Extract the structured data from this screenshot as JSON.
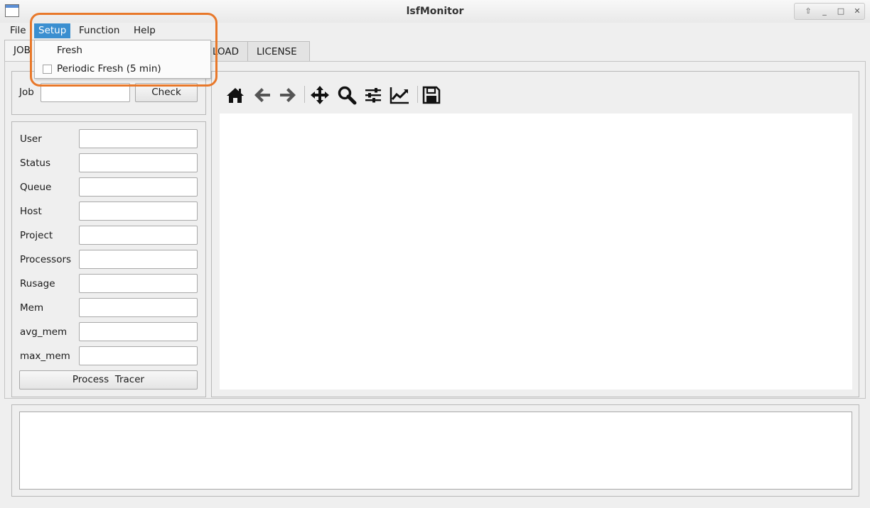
{
  "window": {
    "title": "lsfMonitor",
    "controls": [
      "⇧",
      "_",
      "□",
      "✕"
    ]
  },
  "menubar": {
    "items": [
      "File",
      "Setup",
      "Function",
      "Help"
    ],
    "active": "Setup"
  },
  "setup_menu": {
    "items": [
      {
        "label": "Fresh",
        "checkable": false
      },
      {
        "label": "Periodic Fresh (5 min)",
        "checkable": true,
        "checked": false
      }
    ]
  },
  "tabs": [
    "JOB",
    "LOAD",
    "LICENSE"
  ],
  "job_check": {
    "label": "Job",
    "value": "",
    "button": "Check"
  },
  "job_fields": [
    "User",
    "Status",
    "Queue",
    "Host",
    "Project",
    "Processors",
    "Rusage",
    "Mem",
    "avg_mem",
    "max_mem"
  ],
  "process_tracer_button": "Process  Tracer",
  "plot_toolbar": {
    "icons": [
      "home-icon",
      "back-arrow-icon",
      "forward-arrow-icon",
      "pan-icon",
      "zoom-icon",
      "configure-subplots-icon",
      "edit-curves-icon",
      "save-icon"
    ]
  },
  "colors": {
    "accent": "#3b8fd0",
    "highlight": "#e8782a"
  }
}
